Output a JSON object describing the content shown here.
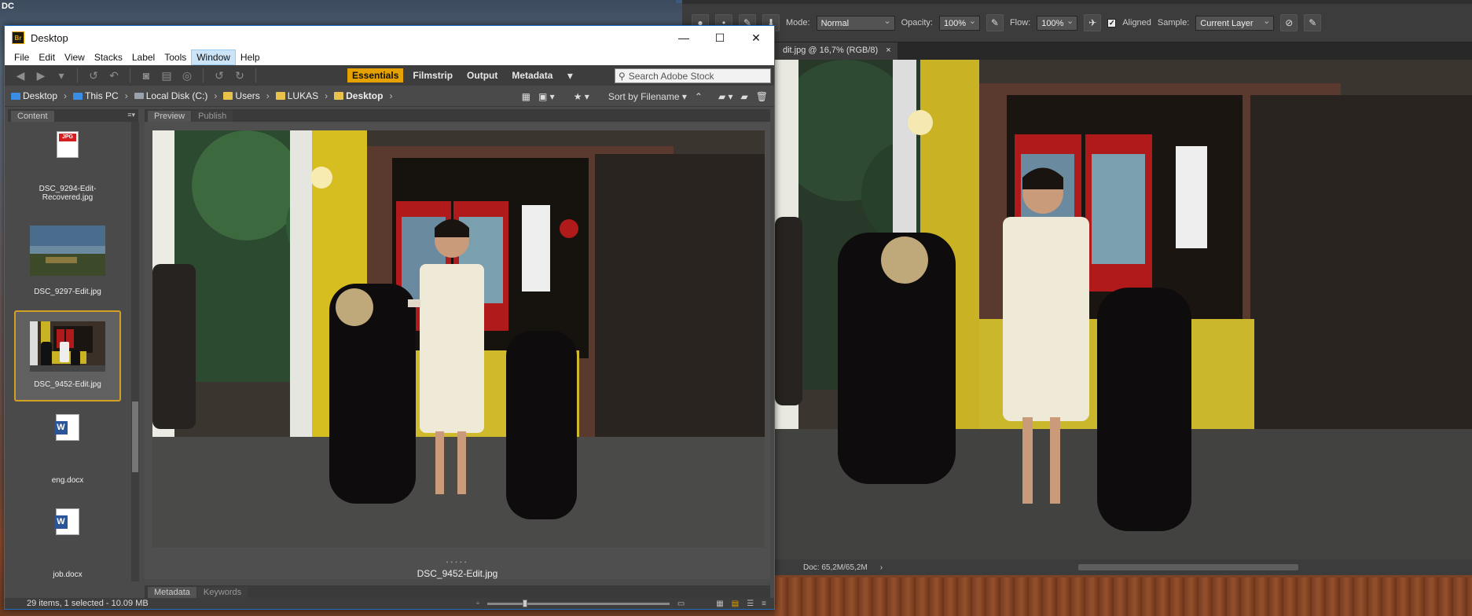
{
  "desktop": {
    "corner_label": "DC"
  },
  "photoshop": {
    "options": {
      "mode_label": "Mode:",
      "mode_value": "Normal",
      "opacity_label": "Opacity:",
      "opacity_value": "100%",
      "flow_label": "Flow:",
      "flow_value": "100%",
      "aligned_label": "Aligned",
      "sample_label": "Sample:",
      "sample_value": "Current Layer"
    },
    "tab_title": "dit.jpg @ 16,7% (RGB/8)",
    "tab_close": "×",
    "status_doc": "Doc: 65,2M/65,2M",
    "status_arrow": "›"
  },
  "bridge": {
    "logo": "Br",
    "window_title": "Desktop",
    "menu": [
      "File",
      "Edit",
      "View",
      "Stacks",
      "Label",
      "Tools",
      "Window",
      "Help"
    ],
    "active_menu_index": 6,
    "workspaces": [
      "Essentials",
      "Filmstrip",
      "Output",
      "Metadata"
    ],
    "search_placeholder": "Search Adobe Stock",
    "path": [
      "Desktop",
      "This PC",
      "Local Disk (C:)",
      "Users",
      "LUKAS",
      "Desktop"
    ],
    "sort_label": "Sort by Filename",
    "panels": {
      "content": "Content",
      "preview": "Preview",
      "publish": "Publish",
      "metadata": "Metadata",
      "keywords": "Keywords"
    },
    "thumbnails": [
      {
        "label": "DSC_9294-Edit-Recovered.jpg",
        "kind": "jpg-icon",
        "icon_text": "JPG"
      },
      {
        "label": "DSC_9297-Edit.jpg",
        "kind": "landscape-photo"
      },
      {
        "label": "DSC_9452-Edit.jpg",
        "kind": "storefront-photo",
        "selected": true
      },
      {
        "label": "eng.docx",
        "kind": "word-icon",
        "icon_text": "W"
      },
      {
        "label": "job.docx",
        "kind": "word-icon",
        "icon_text": "W"
      }
    ],
    "preview_filename": "DSC_9452-Edit.jpg",
    "status_text": "29 items, 1 selected - 10.09 MB",
    "zoom_fraction": 0.2
  },
  "colors": {
    "accent": "#e5a100",
    "selection_border": "#d2a024",
    "title_border": "#1a6fc4"
  }
}
